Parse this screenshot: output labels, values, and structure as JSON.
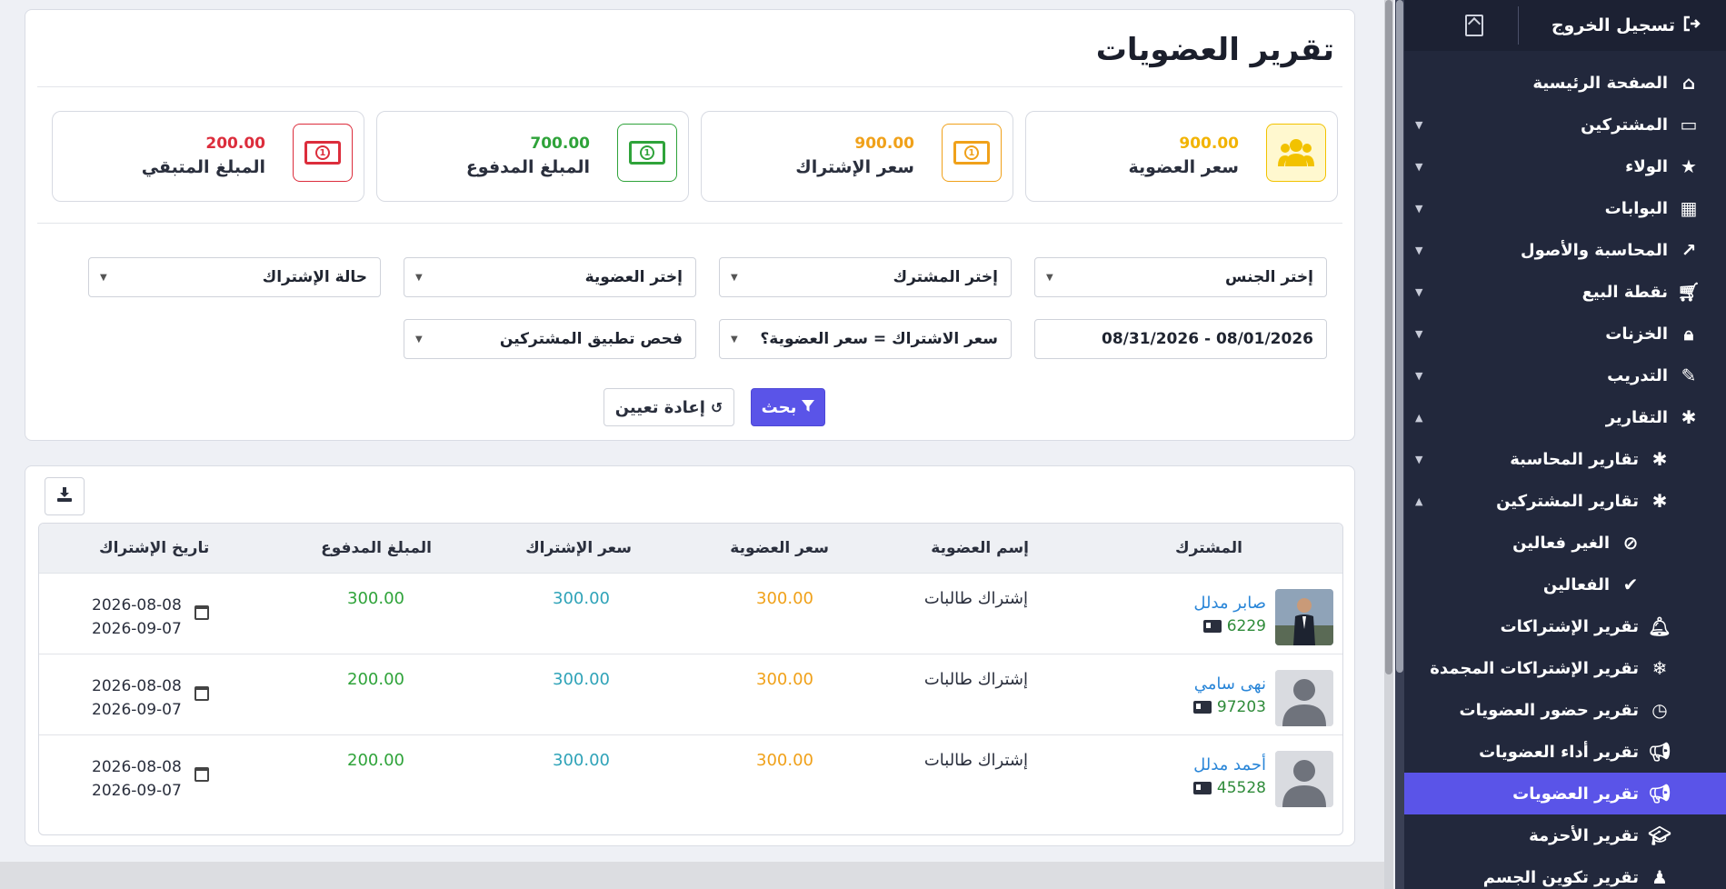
{
  "sidebar": {
    "logout_label": "تسجيل الخروج",
    "items": [
      {
        "label": "الصفحة الرئيسية",
        "icon": "home-icon"
      },
      {
        "label": "المشتركين",
        "icon": "laptop-icon"
      },
      {
        "label": "الولاء",
        "icon": "star-icon"
      },
      {
        "label": "البوابات",
        "icon": "building-icon"
      },
      {
        "label": "المحاسبة والأصول",
        "icon": "chart-line-icon"
      },
      {
        "label": "نقطة البيع",
        "icon": "cart-icon"
      },
      {
        "label": "الخزنات",
        "icon": "lock-icon"
      },
      {
        "label": "التدريب",
        "icon": "magic-wand-icon"
      },
      {
        "label": "التقارير",
        "icon": "bug-icon"
      },
      {
        "label": "تقارير المحاسبة",
        "icon": "bug-icon"
      },
      {
        "label": "تقارير المشتركين",
        "icon": "bug-icon"
      },
      {
        "label": "الغير فعالين",
        "icon": "ban-icon"
      },
      {
        "label": "الفعالين",
        "icon": "check-icon"
      },
      {
        "label": "تقرير الإشتراكات",
        "icon": "bell-icon"
      },
      {
        "label": "تقرير الإشتراكات المجمدة",
        "icon": "snowflake-icon"
      },
      {
        "label": "تقرير حضور العضويات",
        "icon": "clock-icon"
      },
      {
        "label": "تقرير أداء العضويات",
        "icon": "megaphone-icon"
      },
      {
        "label": "تقرير العضويات",
        "icon": "megaphone-icon"
      },
      {
        "label": "تقرير الأحزمة",
        "icon": "graduation-cap-icon"
      },
      {
        "label": "تقرير تكوين الجسم",
        "icon": "person-icon"
      }
    ]
  },
  "page": {
    "title": "تقرير العضويات"
  },
  "stats": [
    {
      "value": "900.00",
      "label": "سعر العضوية",
      "color": "#f2c200"
    },
    {
      "value": "900.00",
      "label": "سعر الإشتراك",
      "color": "#f0a11a"
    },
    {
      "value": "700.00",
      "label": "المبلغ المدفوع",
      "color": "#2fa33a"
    },
    {
      "value": "200.00",
      "label": "المبلغ المتبقي",
      "color": "#dc2d3c"
    }
  ],
  "filters": {
    "gender": "إختر الجنس",
    "member": "إختر المشترك",
    "membership": "إختر العضوية",
    "status": "حالة الإشتراك",
    "date_range": "08/31/2026 - 08/01/2026",
    "price_compare": "سعر الاشتراك = سعر العضوية؟",
    "app_check": "فحص تطبيق المشتركين",
    "search_label": "بحث",
    "reset_label": "إعادة تعيين"
  },
  "table": {
    "headers": {
      "member": "المشترك",
      "membership": "إسم العضوية",
      "membership_price": "سعر العضوية",
      "subscription_price": "سعر الإشتراك",
      "paid": "المبلغ المدفوع",
      "date": "تاريخ الإشتراك"
    },
    "rows": [
      {
        "name": "صابر مدلل",
        "id": "6229",
        "plan": "إشتراك طالبات",
        "price": "300.00",
        "sub": "300.00",
        "paid": "300.00",
        "start": "2026-08-08",
        "end": "2026-09-07"
      },
      {
        "name": "نهى سامي",
        "id": "97203",
        "plan": "إشتراك طالبات",
        "price": "300.00",
        "sub": "300.00",
        "paid": "200.00",
        "start": "2026-08-08",
        "end": "2026-09-07"
      },
      {
        "name": "أحمد مدلل",
        "id": "45528",
        "plan": "إشتراك طالبات",
        "price": "300.00",
        "sub": "300.00",
        "paid": "200.00",
        "start": "2026-08-08",
        "end": "2026-09-07"
      }
    ]
  }
}
